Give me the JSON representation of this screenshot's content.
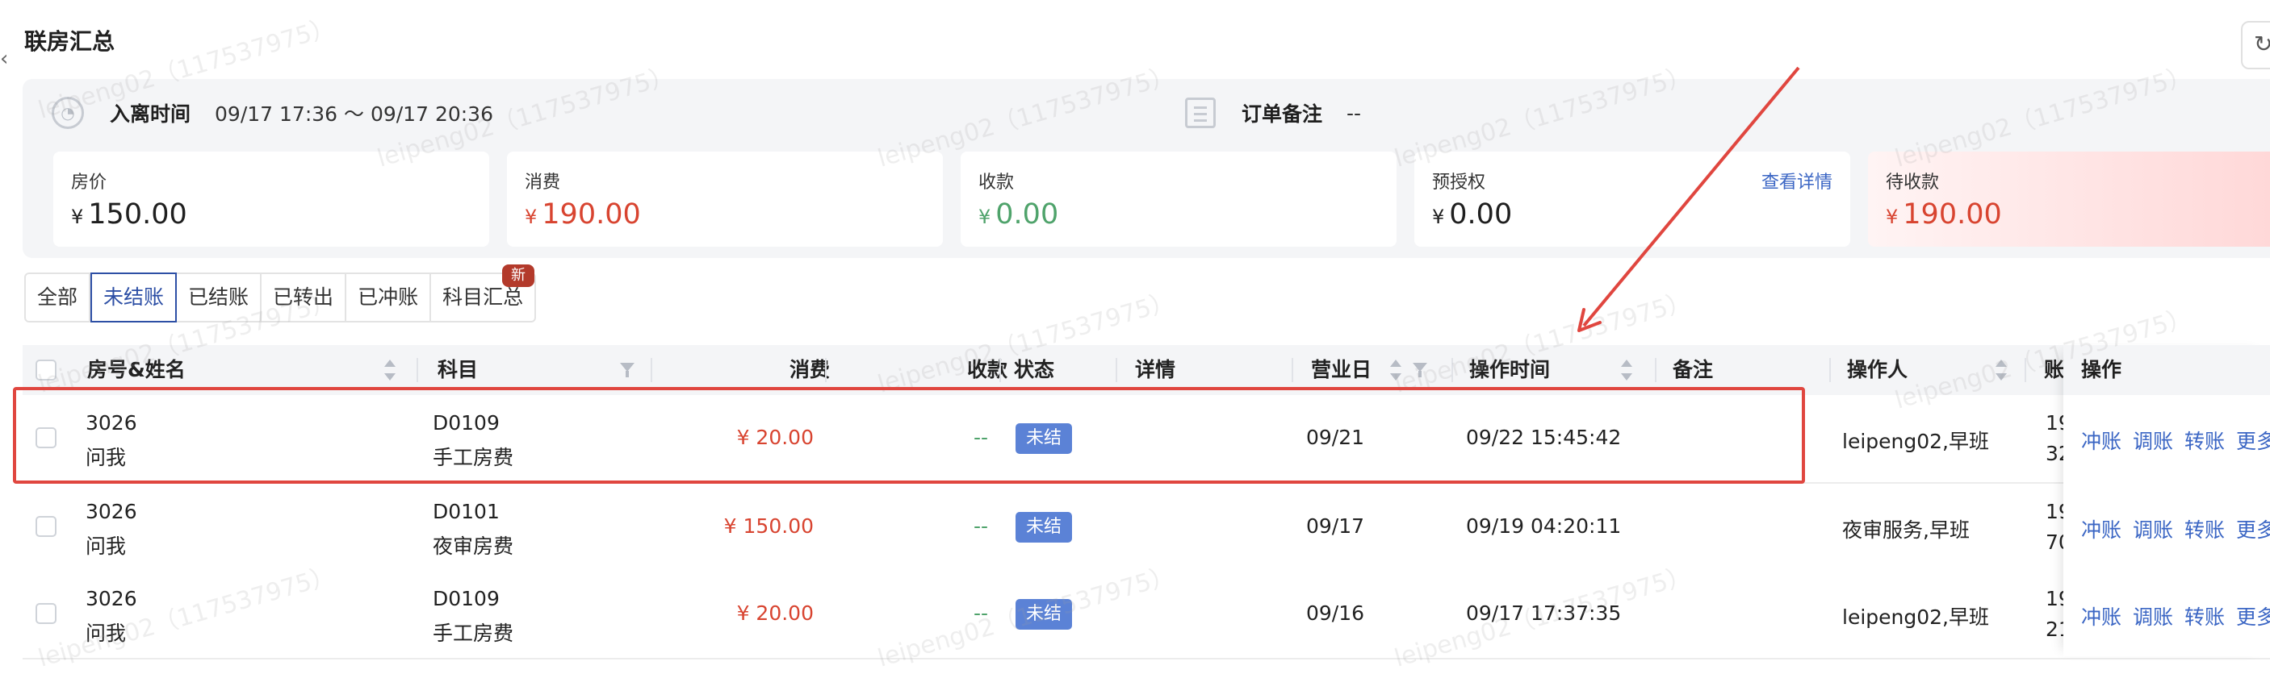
{
  "page": {
    "title": "联房汇总"
  },
  "summary": {
    "checkin_label": "入离时间",
    "checkin_value": "09/17 17:36 ～ 09/17 20:36",
    "note_label": "订单备注",
    "note_value": "--",
    "cards": [
      {
        "label": "房价",
        "currency": "¥",
        "amount": "150.00",
        "color": "#1f1f1f"
      },
      {
        "label": "消费",
        "currency": "¥",
        "amount": "190.00",
        "color": "#d84430"
      },
      {
        "label": "收款",
        "currency": "¥",
        "amount": "0.00",
        "color": "#4fa36b"
      },
      {
        "label": "预授权",
        "currency": "¥",
        "amount": "0.00",
        "color": "#1f1f1f",
        "link": "查看详情"
      },
      {
        "label": "待收款",
        "currency": "¥",
        "amount": "190.00",
        "color": "#d84430"
      }
    ]
  },
  "filters": {
    "tabs": [
      "全部",
      "未结账",
      "已结账",
      "已转出",
      "已冲账",
      "科目汇总"
    ],
    "active": "未结账",
    "new_badge": "新"
  },
  "table": {
    "columns": [
      "房号&姓名",
      "科目",
      "消费",
      "收款",
      "状态",
      "详情",
      "营业日",
      "操作时间",
      "备注",
      "操作人",
      "账"
    ],
    "actions_header": "操作",
    "action_labels": [
      "冲账",
      "调账",
      "转账",
      "更多"
    ],
    "rows": [
      {
        "room": "3026",
        "name": "问我",
        "code": "D0109",
        "subject": "手工房费",
        "consume": "¥ 20.00",
        "receipt": "--",
        "status": "未结",
        "business_day": "09/21",
        "op_time": "09/22 15:45:42",
        "operator": "leipeng02,早班",
        "acct_top": "19",
        "acct_bottom": "32"
      },
      {
        "room": "3026",
        "name": "问我",
        "code": "D0101",
        "subject": "夜审房费",
        "consume": "¥ 150.00",
        "receipt": "--",
        "status": "未结",
        "business_day": "09/17",
        "op_time": "09/19 04:20:11",
        "operator": "夜审服务,早班",
        "acct_top": "19",
        "acct_bottom": "70"
      },
      {
        "room": "3026",
        "name": "问我",
        "code": "D0109",
        "subject": "手工房费",
        "consume": "¥ 20.00",
        "receipt": "--",
        "status": "未结",
        "business_day": "09/16",
        "op_time": "09/17 17:37:35",
        "operator": "leipeng02,早班",
        "acct_top": "19",
        "acct_bottom": "21"
      }
    ]
  },
  "watermark": "leipeng02（117537975）",
  "colors": {
    "accent": "#2d4fa5",
    "link": "#3b66c4",
    "red": "#d84430",
    "green": "#4fa36b",
    "highlight": "#e0463f",
    "badge": "#5b82d6"
  }
}
